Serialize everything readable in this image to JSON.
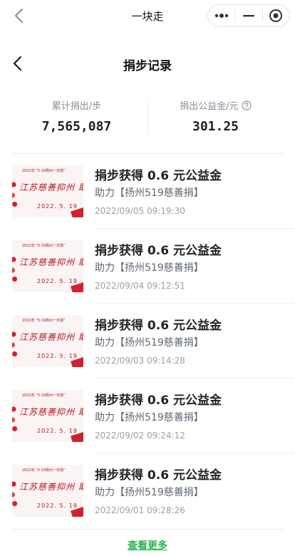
{
  "app": {
    "title": "一块走"
  },
  "page": {
    "title": "捐步记录"
  },
  "stats": {
    "steps_label": "累计捐出/步",
    "steps_value": "7,565,087",
    "fund_label": "捐出公益金/元",
    "fund_value": "301.25"
  },
  "records": [
    {
      "title": "捐步获得 0.6 元公益金",
      "project": "助力【扬州519慈善捐】",
      "time": "2022/09/05 09:19:30",
      "thumb": {
        "header": "2022年 “5·19扬州一日捐”",
        "calligraphy": "江苏慈善抑州 助力共同富裕",
        "date": "2022. 5. 19"
      }
    },
    {
      "title": "捐步获得 0.6 元公益金",
      "project": "助力【扬州519慈善捐】",
      "time": "2022/09/04 09:12:51",
      "thumb": {
        "header": "2022年 “5·19扬州一日捐”",
        "calligraphy": "江苏慈善抑州 助力共同富裕",
        "date": "2022. 5. 19"
      }
    },
    {
      "title": "捐步获得 0.6 元公益金",
      "project": "助力【扬州519慈善捐】",
      "time": "2022/09/03 09:14:28",
      "thumb": {
        "header": "2022年 “5·19扬州一日捐”",
        "calligraphy": "江苏慈善抑州 助力共同富裕",
        "date": "2022. 5. 19"
      }
    },
    {
      "title": "捐步获得 0.6 元公益金",
      "project": "助力【扬州519慈善捐】",
      "time": "2022/09/02 09:24:12",
      "thumb": {
        "header": "2022年 “5·19扬州一日捐”",
        "calligraphy": "江苏慈善抑州 助力共同富裕",
        "date": "2022. 5. 19"
      }
    },
    {
      "title": "捐步获得 0.6 元公益金",
      "project": "助力【扬州519慈善捐】",
      "time": "2022/09/01 09:28:26",
      "thumb": {
        "header": "2022年 “5·19扬州一日捐”",
        "calligraphy": "江苏慈善抑州 助力共同富裕",
        "date": "2022. 5. 19"
      }
    }
  ],
  "footer": {
    "more_label": "查看更多"
  },
  "colors": {
    "accent_green": "#29b24d",
    "text_primary": "#222222",
    "text_secondary": "#5e6673",
    "text_muted": "#9aa0a8",
    "thumb_red": "#b3141c"
  },
  "icons": {
    "nav_back": "chevron-left-icon",
    "more": "more-dots-icon",
    "minimize": "minimize-icon",
    "close": "target-close-icon",
    "help": "question-circle-icon"
  }
}
